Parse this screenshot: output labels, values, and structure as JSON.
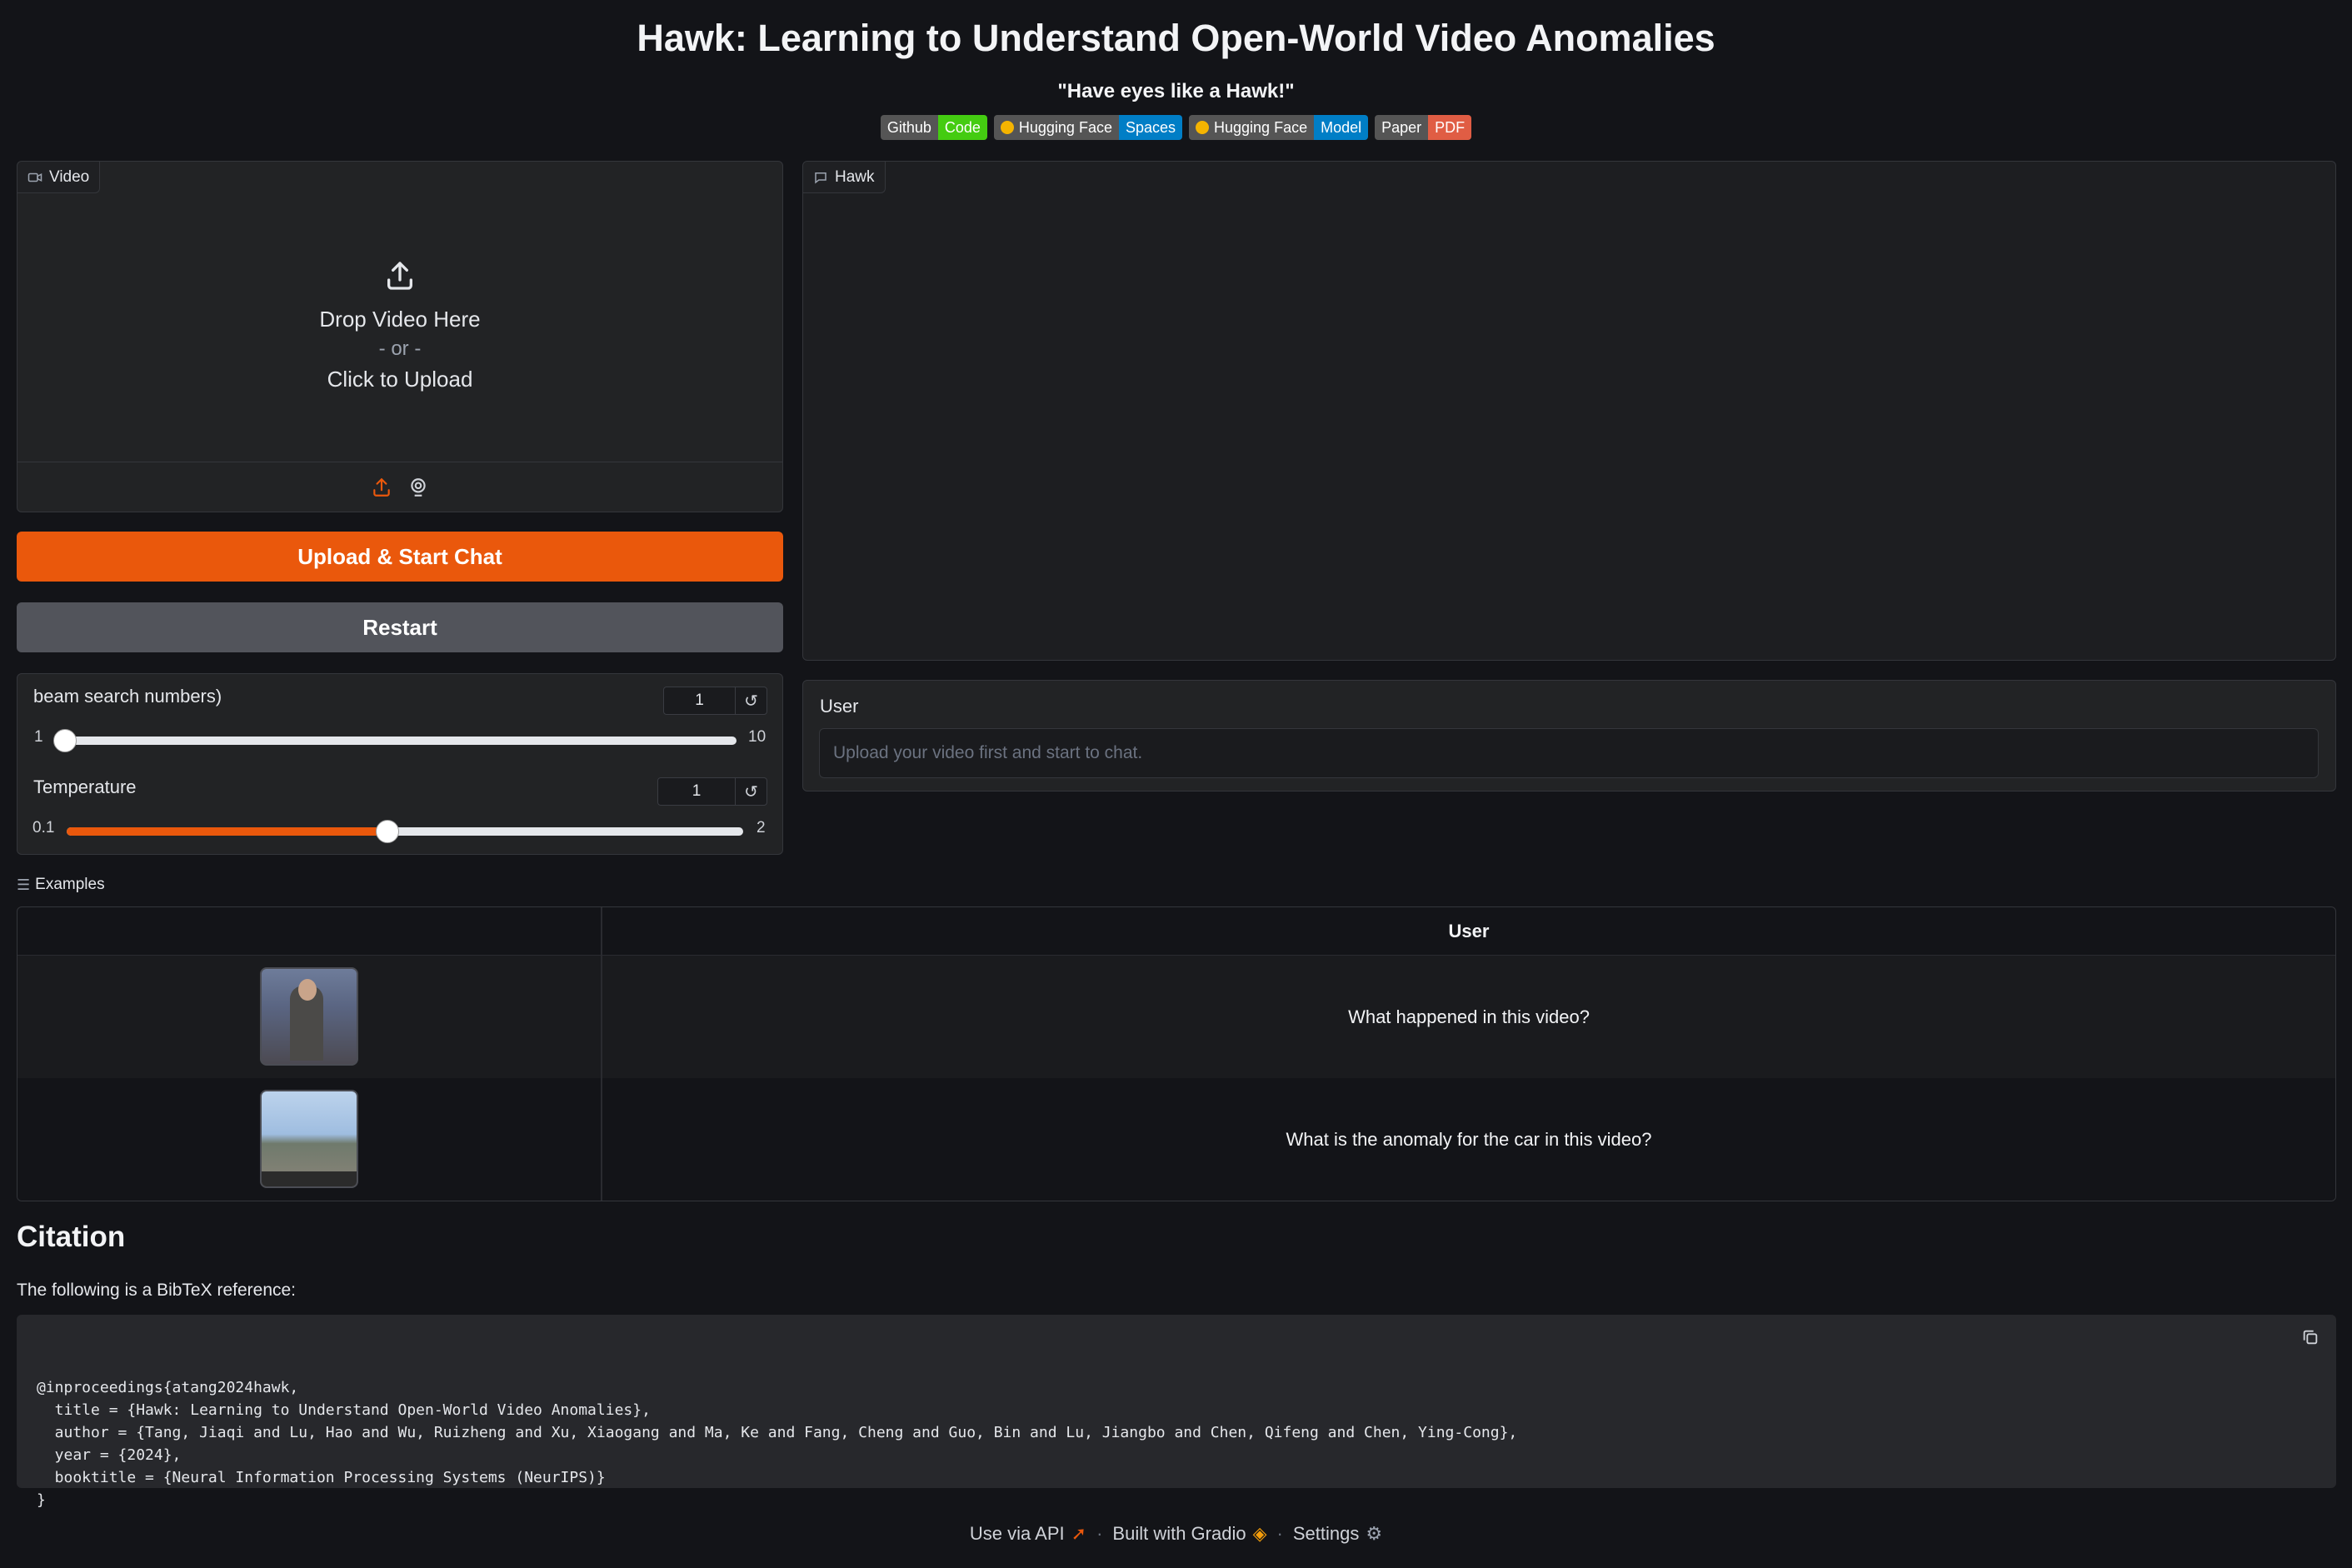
{
  "header": {
    "title": "Hawk: Learning to Understand Open-World Video Anomalies",
    "tagline": "\"Have eyes like a Hawk!\"",
    "badges": [
      {
        "left": "Github",
        "right": "Code",
        "color": "#44cc11"
      },
      {
        "left": "Hugging Face",
        "right": "Spaces",
        "color": "#007ec6"
      },
      {
        "left": "Hugging Face",
        "right": "Model",
        "color": "#007ec6"
      },
      {
        "left": "Paper",
        "right": "PDF",
        "color": "#e05d44"
      }
    ]
  },
  "video": {
    "label": "Video",
    "drop_line1": "Drop Video Here",
    "drop_or": "- or -",
    "drop_line2": "Click to Upload"
  },
  "buttons": {
    "upload_start": "Upload & Start Chat",
    "restart": "Restart"
  },
  "params": {
    "beam": {
      "label": "beam search numbers)",
      "value": "1",
      "min": "1",
      "max": "10",
      "fraction": 0.0
    },
    "temperature": {
      "label": "Temperature",
      "value": "1",
      "min": "0.1",
      "max": "2",
      "fraction": 0.4737
    }
  },
  "chat": {
    "label": "Hawk",
    "user_label": "User",
    "input_placeholder": "Upload your video first and start to chat."
  },
  "examples": {
    "label": "Examples",
    "column_header": "User",
    "rows": [
      {
        "text": "What happened in this video?"
      },
      {
        "text": "What is the anomaly for the car in this video?"
      }
    ]
  },
  "citation": {
    "title": "Citation",
    "intro": "The following is a BibTeX reference:",
    "bibtex": "@inproceedings{atang2024hawk,\n  title = {Hawk: Learning to Understand Open-World Video Anomalies},\n  author = {Tang, Jiaqi and Lu, Hao and Wu, Ruizheng and Xu, Xiaogang and Ma, Ke and Fang, Cheng and Guo, Bin and Lu, Jiangbo and Chen, Qifeng and Chen, Ying-Cong},\n  year = {2024},\n  booktitle = {Neural Information Processing Systems (NeurIPS)}\n}"
  },
  "footer": {
    "api": "Use via API",
    "built": "Built with Gradio",
    "settings": "Settings",
    "sep": "·"
  },
  "colors": {
    "accent": "#ea580c",
    "background": "#131418",
    "panel": "#222325"
  }
}
